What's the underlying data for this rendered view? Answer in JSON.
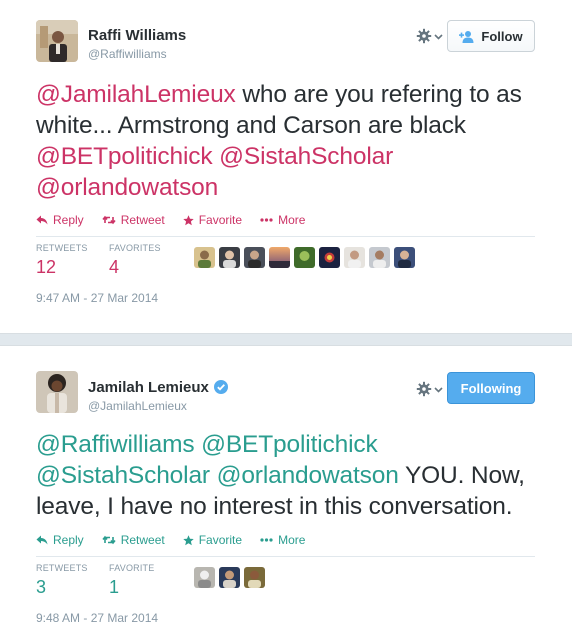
{
  "tweets": [
    {
      "name": "Raffi Williams",
      "handle": "@Raffiwilliams",
      "follow_label": "Follow",
      "text": {
        "m1": "@JamilahLemieux",
        "t1": " who are you refering to as white... Armstrong and Carson are black ",
        "m2": "@BETpolitichick",
        "t2": " ",
        "m3": "@SistahScholar",
        "t3": " ",
        "m4": "@orlandowatson",
        "t4": ""
      },
      "actions": {
        "reply": "Reply",
        "retweet": "Retweet",
        "favorite": "Favorite",
        "more": "More"
      },
      "stats": {
        "retweets_label": "RETWEETS",
        "retweets": "12",
        "favorites_label": "FAVORITES",
        "favorites": "4"
      },
      "timestamp": "9:47 AM - 27 Mar 2014",
      "accent": "#cc3366"
    },
    {
      "name": "Jamilah Lemieux",
      "handle": "@JamilahLemieux",
      "follow_label": "Following",
      "text": {
        "m1": "@Raffiwilliams",
        "t1": " ",
        "m2": "@BETpolitichick",
        "t2": " ",
        "m3": "@SistahScholar",
        "t3": " ",
        "m4": "@orlandowatson",
        "t4": " YOU. Now, leave, I have no interest in this conversation."
      },
      "actions": {
        "reply": "Reply",
        "retweet": "Retweet",
        "favorite": "Favorite",
        "more": "More"
      },
      "stats": {
        "retweets_label": "RETWEETS",
        "retweets": "3",
        "favorites_label": "FAVORITE",
        "favorites": "1"
      },
      "timestamp": "9:48 AM - 27 Mar 2014",
      "accent": "#2a9d8f"
    }
  ],
  "icons": {
    "reply": "reply-arrow-icon",
    "retweet": "retweet-icon",
    "favorite": "star-icon",
    "more": "ellipsis-icon",
    "gear": "gear-icon",
    "follow": "add-person-icon",
    "verified": "verified-badge-icon"
  },
  "colors": {
    "verified": "#55acee",
    "following": "#55acee"
  }
}
